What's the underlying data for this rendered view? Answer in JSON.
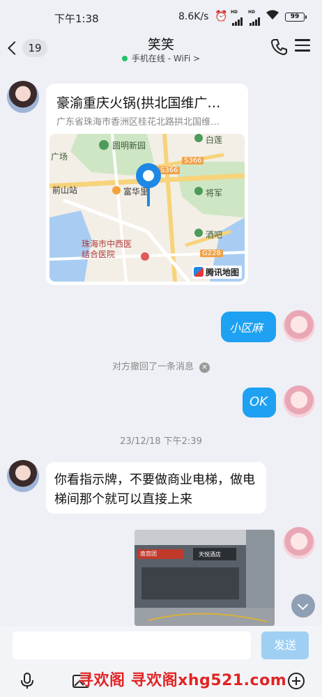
{
  "status_bar": {
    "time": "下午1:38",
    "network_speed": "8.6K/s",
    "battery": "99"
  },
  "header": {
    "back_badge": "19",
    "title": "笑笑",
    "subtitle": "手机在线 - WiFi >"
  },
  "messages": {
    "location": {
      "name": "豪渝重庆火锅(拱北国维广…",
      "address": "广东省珠海市香洲区桂花北路拱北国维…",
      "map_labels": {
        "park": "圆明新园",
        "place_top_left": "广场",
        "station": "前山站",
        "poi": "富华里",
        "hospital": "珠海市中西医\n结合医院",
        "bailian": "白莲",
        "jiangjun": "将军",
        "bar": "酒吧",
        "road_s366_a": "S366",
        "road_s366_b": "S366",
        "road_g228": "G228",
        "provider": "腾讯地图"
      }
    },
    "sent_handwritten": "小区麻",
    "recall_notice": "对方撤回了一条消息",
    "sent_ok": "OK",
    "timestamp": "23/12/18 下午2:39",
    "received_text": "你看指示牌，不要做商业电梯，做电梯间那个就可以直接上来",
    "photo": {
      "sign_left": "南宫团",
      "sign_right": "天悦酒店"
    }
  },
  "input": {
    "placeholder": "",
    "send_label": "发送"
  },
  "watermark": "寻欢阁 寻欢阁xhg521.com",
  "colors": {
    "accent_blue": "#1ea1f2",
    "send_disabled": "#9fd0f3",
    "background": "#eef0f5",
    "online_green": "#23c16b"
  },
  "icons": [
    "back-chevron-icon",
    "phone-icon",
    "menu-icon",
    "map-pin-icon",
    "voice-icon",
    "image-icon",
    "add-icon",
    "scroll-down-icon"
  ]
}
